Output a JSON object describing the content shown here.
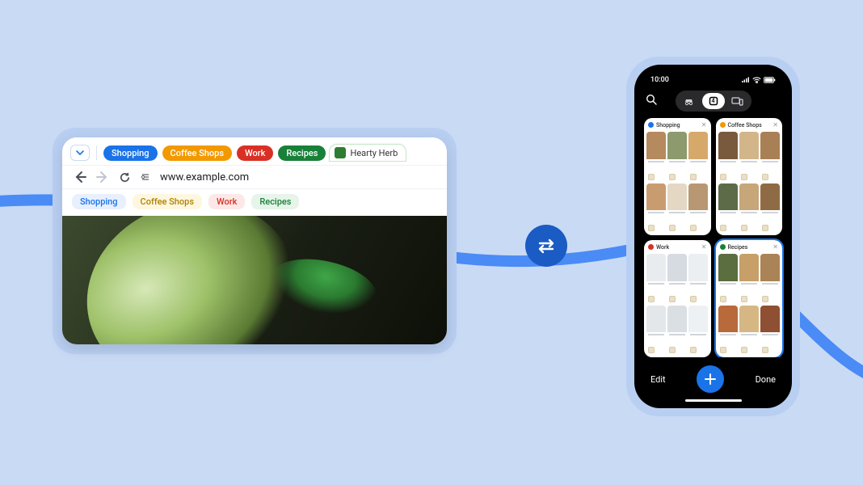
{
  "desktop": {
    "tab_groups": [
      {
        "label": "Shopping",
        "color": "#1a73e8"
      },
      {
        "label": "Coffee Shops",
        "color": "#f29900"
      },
      {
        "label": "Work",
        "color": "#d93025"
      },
      {
        "label": "Recipes",
        "color": "#188038"
      }
    ],
    "active_tab_label": "Hearty Herb",
    "url": "www.example.com",
    "bookmarks": [
      {
        "label": "Shopping",
        "variant": "blue"
      },
      {
        "label": "Coffee Shops",
        "variant": "amber"
      },
      {
        "label": "Work",
        "variant": "red"
      },
      {
        "label": "Recipes",
        "variant": "green"
      }
    ]
  },
  "phone": {
    "time": "10:00",
    "tab_count": "4",
    "groups": [
      {
        "label": "Shopping",
        "dot": "blue",
        "selected": false
      },
      {
        "label": "Coffee Shops",
        "dot": "amber",
        "selected": false
      },
      {
        "label": "Work",
        "dot": "red",
        "selected": false
      },
      {
        "label": "Recipes",
        "dot": "green",
        "selected": true
      }
    ],
    "edit_label": "Edit",
    "done_label": "Done"
  }
}
